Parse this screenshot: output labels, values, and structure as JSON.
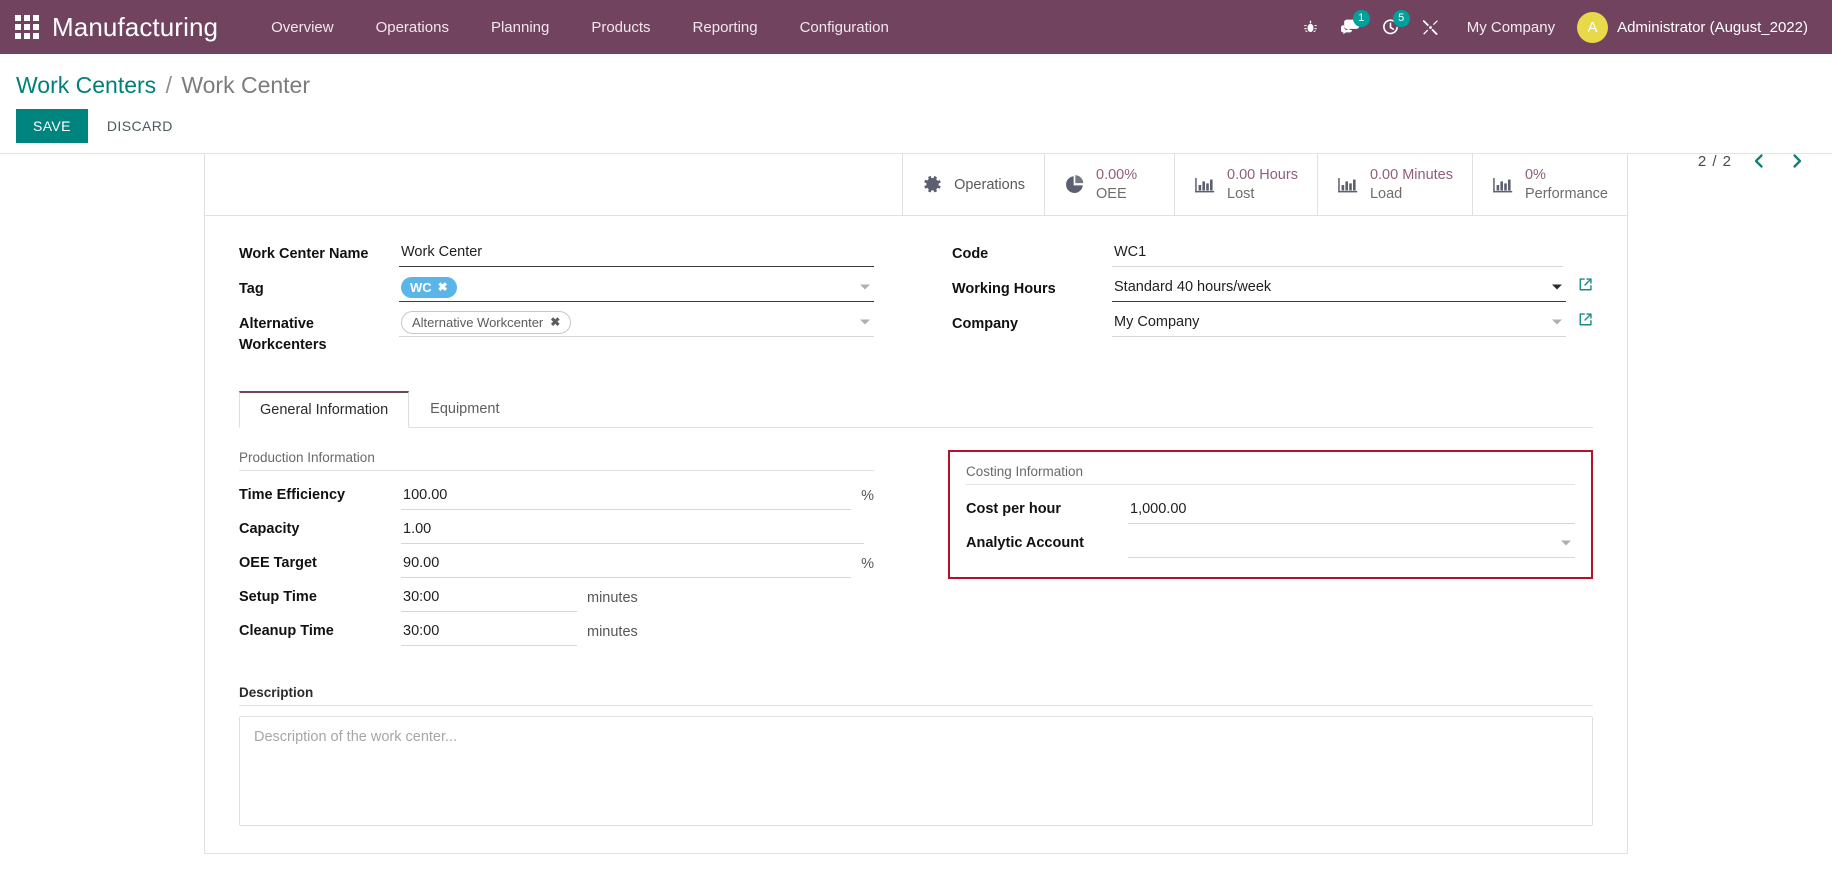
{
  "navbar": {
    "apps_icon": "apps-grid-icon",
    "brand": "Manufacturing",
    "menu": [
      {
        "label": "Overview"
      },
      {
        "label": "Operations"
      },
      {
        "label": "Planning"
      },
      {
        "label": "Products"
      },
      {
        "label": "Reporting"
      },
      {
        "label": "Configuration"
      }
    ],
    "systray": [
      {
        "icon": "bug-icon",
        "badge": null
      },
      {
        "icon": "messaging-icon",
        "badge": "1"
      },
      {
        "icon": "activities-clock-icon",
        "badge": "5"
      },
      {
        "icon": "tools-icon",
        "badge": null
      }
    ],
    "company": "My Company",
    "avatar_initial": "A",
    "user": "Administrator (August_2022)",
    "colors": {
      "navbar_bg": "#71435f",
      "badge_bg": "#00a09d",
      "avatar_bg": "#e8d94a"
    }
  },
  "control_panel": {
    "breadcrumb": {
      "root": "Work Centers",
      "separator": "/",
      "current": "Work Center"
    },
    "save_label": "SAVE",
    "discard_label": "DISCARD",
    "pager": {
      "value": "2 / 2",
      "prev_icon": "chevron-left-icon",
      "next_icon": "chevron-right-icon"
    },
    "colors": {
      "save_bg": "#00847f",
      "breadcrumb_link": "#018079"
    }
  },
  "stat_buttons": [
    {
      "icon": "gear-icon",
      "value": "",
      "label": "Operations",
      "single": true
    },
    {
      "icon": "pie-chart-icon",
      "value": "0.00%",
      "label": "OEE",
      "single": false
    },
    {
      "icon": "bar-chart-icon",
      "value": "0.00 Hours",
      "label": "Lost",
      "single": false
    },
    {
      "icon": "bar-chart-icon",
      "value": "0.00 Minutes",
      "label": "Load",
      "single": false
    },
    {
      "icon": "bar-chart-icon",
      "value": "0%",
      "label": "Performance",
      "single": false
    }
  ],
  "form": {
    "left": {
      "work_center_name": {
        "label": "Work Center Name",
        "value": "Work Center"
      },
      "tag": {
        "label": "Tag",
        "tags": [
          {
            "text": "WC",
            "remove_icon": "✖"
          }
        ]
      },
      "alternative_workcenters": {
        "label": "Alternative Workcenters",
        "tags": [
          {
            "text": "Alternative Workcenter",
            "remove_icon": "✖"
          }
        ]
      }
    },
    "right": {
      "code": {
        "label": "Code",
        "value": "WC1"
      },
      "working_hours": {
        "label": "Working Hours",
        "value": "Standard 40 hours/week",
        "link_icon": "internal-link-icon"
      },
      "company": {
        "label": "Company",
        "value": "My Company",
        "link_icon": "internal-link-icon"
      }
    }
  },
  "notebook": {
    "tabs": [
      {
        "label": "General Information",
        "active": true
      },
      {
        "label": "Equipment",
        "active": false
      }
    ]
  },
  "general_information": {
    "production": {
      "title": "Production Information",
      "fields": [
        {
          "label": "Time Efficiency",
          "value": "100.00",
          "suffix": "%"
        },
        {
          "label": "Capacity",
          "value": "1.00",
          "suffix": ""
        },
        {
          "label": "OEE Target",
          "value": "90.00",
          "suffix": "%"
        },
        {
          "label": "Setup Time",
          "value": "30:00",
          "suffix": "minutes"
        },
        {
          "label": "Cleanup Time",
          "value": "30:00",
          "suffix": "minutes"
        }
      ]
    },
    "costing": {
      "title": "Costing Information",
      "highlight_color": "#b5112a",
      "fields": [
        {
          "label": "Cost per hour",
          "value": "1,000.00",
          "type": "input"
        },
        {
          "label": "Analytic Account",
          "value": "",
          "type": "select"
        }
      ]
    },
    "description": {
      "label": "Description",
      "value": "",
      "placeholder": "Description of the work center..."
    }
  }
}
